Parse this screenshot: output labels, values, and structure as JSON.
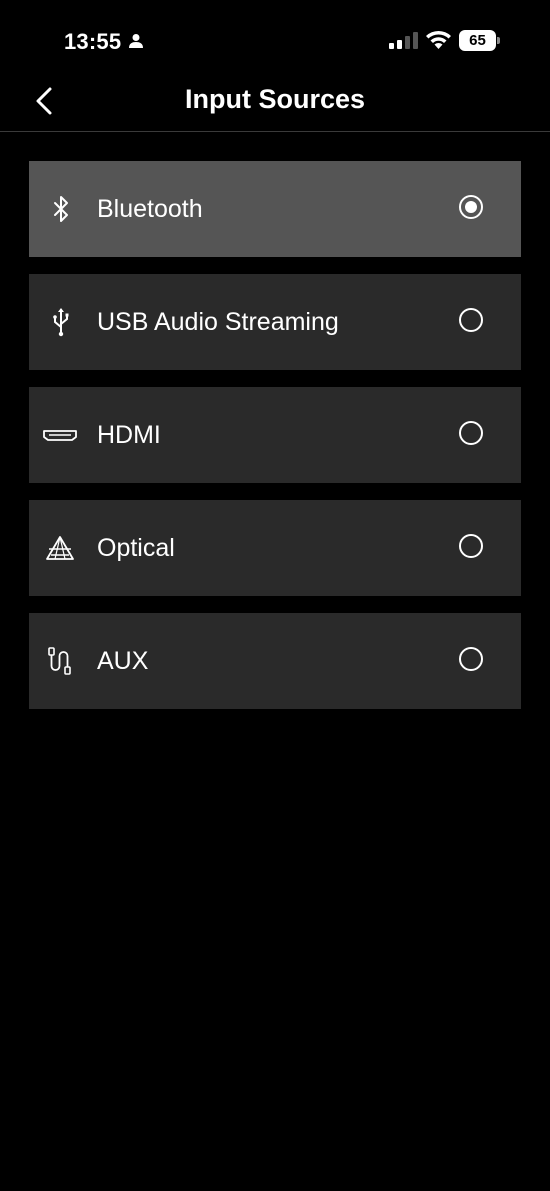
{
  "status_bar": {
    "time": "13:55",
    "battery": "65",
    "icons": [
      "person-icon",
      "cellular-signal-icon",
      "wifi-icon",
      "battery-icon"
    ]
  },
  "header": {
    "title": "Input Sources",
    "back_icon": "chevron-left-icon"
  },
  "sources": [
    {
      "label": "Bluetooth",
      "icon": "bluetooth-icon",
      "selected": true
    },
    {
      "label": "USB Audio Streaming",
      "icon": "usb-icon",
      "selected": false
    },
    {
      "label": "HDMI",
      "icon": "hdmi-icon",
      "selected": false
    },
    {
      "label": "Optical",
      "icon": "optical-icon",
      "selected": false
    },
    {
      "label": "AUX",
      "icon": "aux-cable-icon",
      "selected": false
    }
  ],
  "colors": {
    "background": "#000000",
    "item_background": "#2a2a2a",
    "item_selected_background": "#555555",
    "text": "#ffffff"
  }
}
